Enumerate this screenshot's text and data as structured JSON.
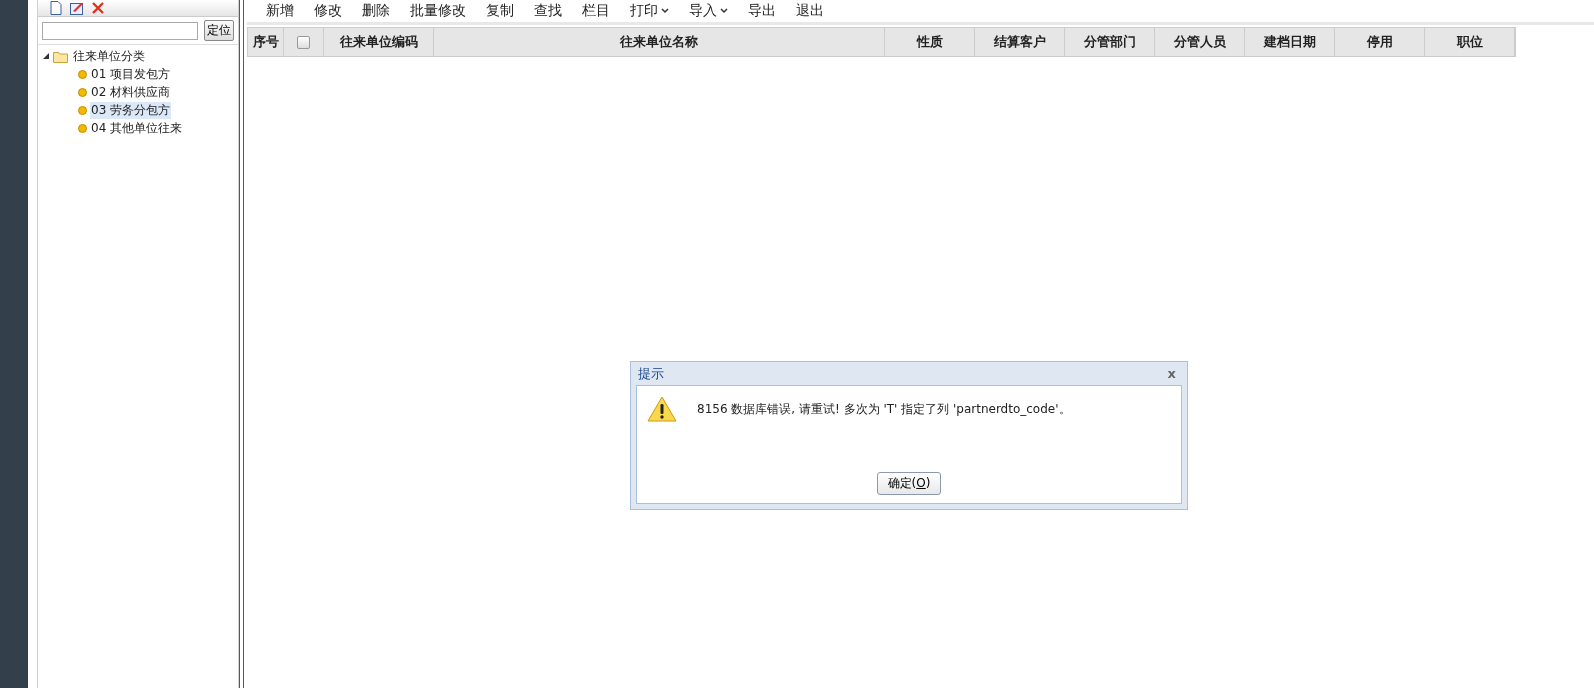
{
  "sidebar": {
    "search": {
      "button": "定位"
    },
    "tree": [
      {
        "label": "往来单位分类",
        "expanded": true,
        "selected": false,
        "children": [
          {
            "label": "01 项目发包方",
            "selected": false
          },
          {
            "label": "02 材料供应商",
            "selected": false
          },
          {
            "label": "03 劳务分包方",
            "selected": true
          },
          {
            "label": "04 其他单位往来",
            "selected": false
          }
        ]
      }
    ]
  },
  "toolbar": [
    {
      "label": "新增",
      "kind": "plain"
    },
    {
      "label": "修改",
      "kind": "plain"
    },
    {
      "label": "删除",
      "kind": "plain"
    },
    {
      "label": "批量修改",
      "kind": "plain"
    },
    {
      "label": "复制",
      "kind": "plain"
    },
    {
      "label": "查找",
      "kind": "plain"
    },
    {
      "label": "栏目",
      "kind": "plain"
    },
    {
      "label": "打印",
      "kind": "dropdown"
    },
    {
      "label": "导入",
      "kind": "dropdown"
    },
    {
      "label": "导出",
      "kind": "plain"
    },
    {
      "label": "退出",
      "kind": "plain"
    }
  ],
  "table": {
    "columns": [
      {
        "label": "序号",
        "kind": "text"
      },
      {
        "kind": "checkbox",
        "checked": false
      },
      {
        "label": "往来单位编码",
        "kind": "text"
      },
      {
        "label": "往来单位名称",
        "kind": "text"
      },
      {
        "label": "性质",
        "kind": "text"
      },
      {
        "label": "结算客户",
        "kind": "text"
      },
      {
        "label": "分管部门",
        "kind": "text"
      },
      {
        "label": "分管人员",
        "kind": "text"
      },
      {
        "label": "建档日期",
        "kind": "text"
      },
      {
        "label": "停用",
        "kind": "text"
      },
      {
        "label": "职位",
        "kind": "text"
      }
    ]
  },
  "dialog": {
    "title": "提示",
    "close": "x",
    "message": "8156 数据库错误, 请重试! 多次为 'T' 指定了列 'partnerdto_code'。",
    "button": {
      "before": "确定(",
      "accel": "O",
      "after": ")"
    }
  }
}
